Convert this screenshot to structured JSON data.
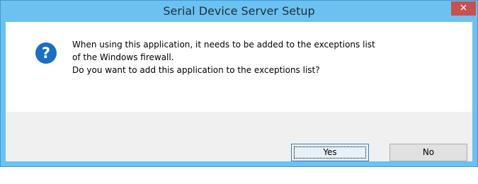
{
  "window": {
    "title": "Serial Device Server Setup",
    "close_glyph": "×"
  },
  "message": {
    "line1": "When using this application, it needs to be added to the exceptions list",
    "line2": "of the Windows firewall.",
    "line3": "Do you want to add this application to the exceptions list?"
  },
  "icon": {
    "name": "question-icon",
    "glyph": "?",
    "color": "#1a6fc2"
  },
  "buttons": {
    "yes_label": "Yes",
    "no_label": "No"
  },
  "colors": {
    "titlebar": "#6cc1f0",
    "close": "#c75050",
    "footer": "#f0f0f0"
  }
}
